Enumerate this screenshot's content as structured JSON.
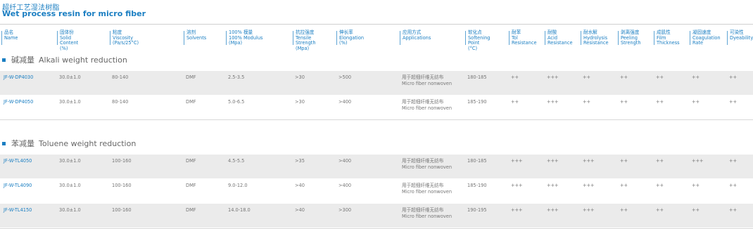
{
  "title": {
    "cn": "超纤工艺湿法树脂",
    "en": "Wet process resin for micro fiber"
  },
  "columns": [
    {
      "cn": "品名",
      "en": [
        "Name"
      ]
    },
    {
      "cn": "固体份",
      "en": [
        "Solid",
        "Content",
        "(%)"
      ]
    },
    {
      "cn": "粘度",
      "en": [
        "Viscosity",
        "(Pa/s/25°C)"
      ]
    },
    {
      "cn": "溶剂",
      "en": [
        "Solvents"
      ]
    },
    {
      "cn": "100% 模量",
      "en": [
        "100% Modulus",
        "(Mpa)"
      ]
    },
    {
      "cn": "抗拉强度",
      "en": [
        "Tensile",
        "Strength",
        "(Mpa)"
      ]
    },
    {
      "cn": "伸长率",
      "en": [
        "Elongation",
        "(%)"
      ]
    },
    {
      "cn": "应用方式",
      "en": [
        "Applications"
      ]
    },
    {
      "cn": "软化点",
      "en": [
        "Softening",
        "Point",
        "(°C)"
      ]
    },
    {
      "cn": "耐苯",
      "en": [
        "Tol",
        "Resistance"
      ]
    },
    {
      "cn": "耐酸",
      "en": [
        "Acid",
        "Resistance"
      ]
    },
    {
      "cn": "耐水解",
      "en": [
        "Hydrolysis",
        "Resistance"
      ]
    },
    {
      "cn": "剥离强度",
      "en": [
        "Peeling",
        "Strength"
      ]
    },
    {
      "cn": "成肌性",
      "en": [
        "Film",
        "Thickness"
      ]
    },
    {
      "cn": "凝固速度",
      "en": [
        "Coagulation",
        "Rate"
      ]
    },
    {
      "cn": "可染性",
      "en": [
        "Dyeability"
      ]
    }
  ],
  "sections": [
    {
      "cn": "碱减量",
      "en": "Alkali weight reduction",
      "rows": [
        [
          "JF-W-DP4030",
          "30.0±1.0",
          "80-140",
          "DMF",
          "2.5-3.5",
          ">30",
          ">500",
          "用于超细纤维无纺布|Micro fiber nonwoven",
          "180-185",
          "++",
          "+++",
          "++",
          "++",
          "++",
          "++",
          "++"
        ],
        [
          "JF-W-DP4050",
          "30.0±1.0",
          "80-140",
          "DMF",
          "5.0-6.5",
          ">30",
          ">400",
          "用于超细纤维无纺布|Micro fiber nonwoven",
          "185-190",
          "++",
          "+++",
          "++",
          "++",
          "++",
          "++",
          "++"
        ]
      ]
    },
    {
      "cn": "苯减量",
      "en": "Toluene weight reduction",
      "rows": [
        [
          "JF-W-TL4050",
          "30.0±1.0",
          "100-160",
          "DMF",
          "4.5-5.5",
          ">35",
          ">400",
          "用于超细纤维无纺布|Micro fiber nonwoven",
          "180-185",
          "+++",
          "+++",
          "+++",
          "++",
          "++",
          "+++",
          "++"
        ],
        [
          "JF-W-TL4090",
          "30.0±1.0",
          "100-160",
          "DMF",
          "9.0-12.0",
          ">40",
          ">400",
          "用于超细纤维无纺布|Micro fiber nonwoven",
          "185-190",
          "+++",
          "+++",
          "+++",
          "++",
          "++",
          "++",
          "++"
        ],
        [
          "JF-W-TL4150",
          "30.0±1.0",
          "100-160",
          "DMF",
          "14.0-18.0",
          ">40",
          ">300",
          "用于超细纤维无纺布|Micro fiber nonwoven",
          "190-195",
          "+++",
          "+++",
          "+++",
          "++",
          "++",
          "++",
          "++"
        ]
      ]
    }
  ],
  "colors": {
    "accent": "#1a7ec2",
    "shade": "#ebebeb"
  }
}
